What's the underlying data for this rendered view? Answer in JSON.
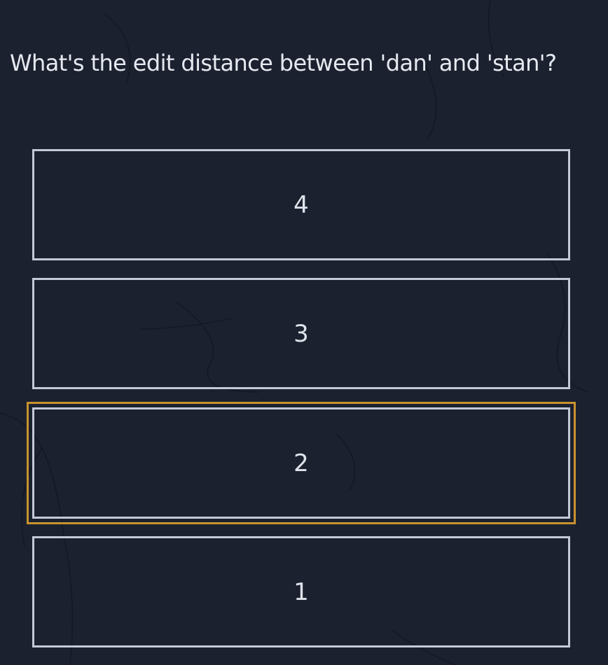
{
  "quiz": {
    "question": "What's the edit distance between 'dan' and 'stan'?",
    "options": [
      {
        "label": "4"
      },
      {
        "label": "3"
      },
      {
        "label": "2"
      },
      {
        "label": "1"
      }
    ],
    "focused_option_index": 2
  },
  "colors": {
    "background": "#1c2130",
    "option_border": "#c3cad6",
    "focus_ring": "#c8922e",
    "text": "#e6e9ef"
  }
}
